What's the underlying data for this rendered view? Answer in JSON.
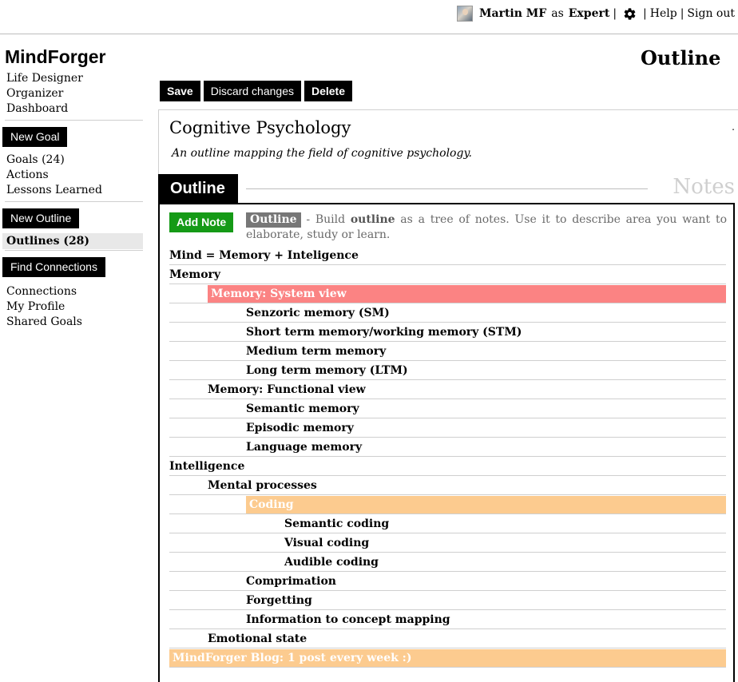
{
  "header": {
    "user_name": "Martin MF",
    "as_label": "as",
    "role": "Expert",
    "separator": "|",
    "help": "Help",
    "sign_out": "Sign out"
  },
  "sidebar": {
    "brand": "MindForger",
    "top_links": [
      "Life Designer",
      "Organizer",
      "Dashboard"
    ],
    "new_goal": "New Goal",
    "goal_links": [
      "Goals (24)",
      "Actions",
      "Lessons Learned"
    ],
    "new_outline": "New Outline",
    "active_item": "Outlines (28)",
    "find_connections": "Find Connections",
    "bottom_links": [
      "Connections",
      "My Profile",
      "Shared Goals"
    ]
  },
  "page_title": "Outline",
  "toolbar": {
    "save": "Save",
    "discard": "Discard changes",
    "delete": "Delete"
  },
  "outline": {
    "name": "Cognitive Psychology",
    "description": "An outline mapping the field of cognitive psychology.",
    "corner_mark": "."
  },
  "tabs": {
    "outline": "Outline",
    "notes": "Notes"
  },
  "panel": {
    "add_note": "Add Note",
    "intro_chip": "Outline",
    "intro_pre": " - Build ",
    "intro_bold": "outline",
    "intro_post": " as a tree of notes. Use it to describe area you want to elaborate, study or learn."
  },
  "notes": [
    {
      "title": "Mind = Memory + Inteligence",
      "depth": 0,
      "highlight": ""
    },
    {
      "title": "Memory",
      "depth": 0,
      "highlight": ""
    },
    {
      "title": "Memory: System view",
      "depth": 1,
      "highlight": "red"
    },
    {
      "title": "Senzoric memory (SM)",
      "depth": 2,
      "highlight": ""
    },
    {
      "title": "Short term memory/working memory (STM)",
      "depth": 2,
      "highlight": ""
    },
    {
      "title": "Medium term memory",
      "depth": 2,
      "highlight": ""
    },
    {
      "title": "Long term memory (LTM)",
      "depth": 2,
      "highlight": ""
    },
    {
      "title": "Memory: Functional view",
      "depth": 1,
      "highlight": ""
    },
    {
      "title": "Semantic memory",
      "depth": 2,
      "highlight": ""
    },
    {
      "title": "Episodic memory",
      "depth": 2,
      "highlight": ""
    },
    {
      "title": "Language memory",
      "depth": 2,
      "highlight": ""
    },
    {
      "title": "Intelligence",
      "depth": 0,
      "highlight": ""
    },
    {
      "title": "Mental processes",
      "depth": 1,
      "highlight": ""
    },
    {
      "title": "Coding",
      "depth": 2,
      "highlight": "orange"
    },
    {
      "title": "Semantic coding",
      "depth": 3,
      "highlight": ""
    },
    {
      "title": "Visual coding",
      "depth": 3,
      "highlight": ""
    },
    {
      "title": "Audible coding",
      "depth": 3,
      "highlight": ""
    },
    {
      "title": "Comprimation",
      "depth": 2,
      "highlight": ""
    },
    {
      "title": "Forgetting",
      "depth": 2,
      "highlight": ""
    },
    {
      "title": "Information to concept mapping",
      "depth": 2,
      "highlight": ""
    },
    {
      "title": "Emotional state",
      "depth": 1,
      "highlight": ""
    },
    {
      "title": "MindForger Blog: 1 post every week :)",
      "depth": 0,
      "highlight": "orange"
    }
  ],
  "colors": {
    "add_note": "#159a16",
    "highlight_red": "#fb8383",
    "highlight_orange": "#fccb8f"
  }
}
